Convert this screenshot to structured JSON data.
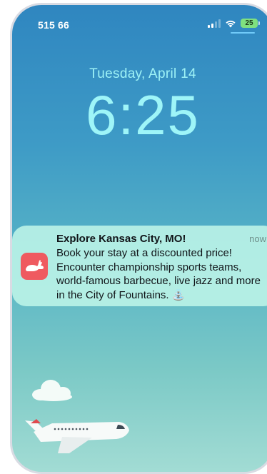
{
  "status_bar": {
    "carrier": "515 66",
    "battery": "25",
    "signal_icon": "cellular-signal-icon",
    "wifi_icon": "wifi-icon"
  },
  "lock_screen": {
    "date": "Tuesday, April 14",
    "time": "6:25"
  },
  "notification": {
    "app_icon": "rabbit-icon",
    "title": "Explore Kansas City, MO!",
    "time": "now",
    "body": "Book your stay at a discounted price! Encounter championship sports teams, world-famous barbecue, live jazz and more in the City of Fountains. ⛲"
  },
  "colors": {
    "app_icon_bg": "#ef5a60",
    "clock_text": "#9ef5f8",
    "notification_bg": "#bef5e8"
  }
}
